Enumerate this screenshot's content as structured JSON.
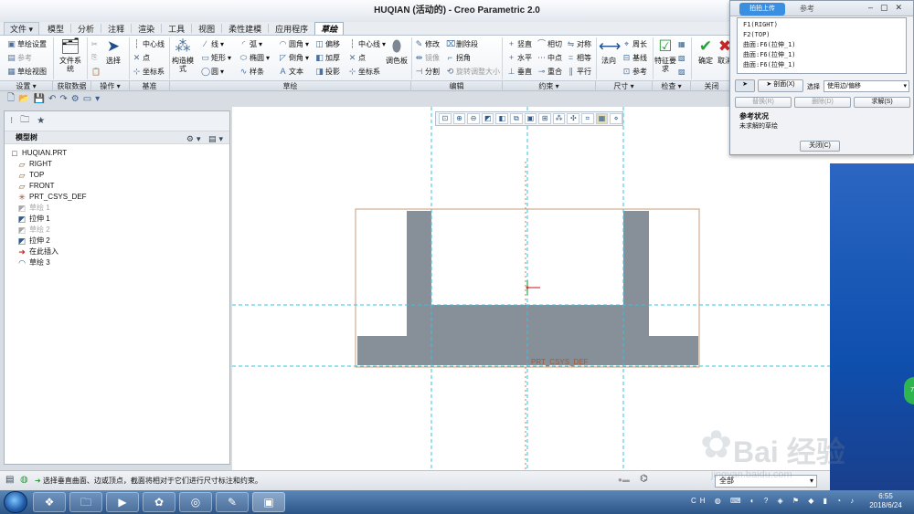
{
  "window": {
    "title": "HUQIAN (活动的) - Creo Parametric 2.0"
  },
  "tabs": [
    {
      "label": "文件 ▾"
    },
    {
      "label": "模型"
    },
    {
      "label": "分析"
    },
    {
      "label": "注释"
    },
    {
      "label": "渲染"
    },
    {
      "label": "工具"
    },
    {
      "label": "视图"
    },
    {
      "label": "柔性建模"
    },
    {
      "label": "应用程序"
    },
    {
      "label": "草绘"
    }
  ],
  "ribbon": {
    "setup": {
      "sketch_setup": "草绘设置",
      "reference": "参考",
      "sketch_view": "草绘视图"
    },
    "data": {
      "file_system": "文件系统"
    },
    "ops": {
      "select": "选择"
    },
    "datum": {
      "centerline": "中心线",
      "point": "点",
      "csys": "坐标系"
    },
    "sketch": {
      "construction": "构造模式",
      "line": "线",
      "rectangle": "矩形",
      "circle": "圆",
      "arc": "弧",
      "ellipse": "椭圆",
      "spline": "样条",
      "fillet": "圆角",
      "chamfer": "倒角",
      "text": "文本",
      "offset": "偏移",
      "thicken": "加厚",
      "project": "投影",
      "centerline": "中心线",
      "point": "点",
      "csys": "坐标系",
      "palette": "调色板"
    },
    "edit": {
      "modify": "修改",
      "mirror": "镜像",
      "divide": "分割",
      "delete_segment": "删除段",
      "corner": "拐角",
      "rotate_resize": "旋转调整大小"
    },
    "constrain": {
      "vertical": "竖直",
      "horizontal": "水平",
      "perpendicular": "垂直",
      "tangent": "相切",
      "midpoint": "中点",
      "coincident": "重合",
      "symmetric": "对称",
      "equal": "相等",
      "parallel": "平行"
    },
    "dimension": {
      "normal": "法向",
      "perimeter": "周长",
      "baseline": "基线",
      "reference": "参考"
    },
    "inspect": {
      "feature_requirements": "特征要求"
    },
    "close": {
      "ok": "确定",
      "cancel": "取消"
    }
  },
  "groups": [
    {
      "label": "设置 ▾"
    },
    {
      "label": "获取数据"
    },
    {
      "label": "操作 ▾"
    },
    {
      "label": "基准"
    },
    {
      "label": "草绘"
    },
    {
      "label": "编辑"
    },
    {
      "label": "约束 ▾"
    },
    {
      "label": "尺寸 ▾"
    },
    {
      "label": "检查 ▾"
    },
    {
      "label": "关闭"
    }
  ],
  "model_tree": {
    "header": "模型树",
    "items": [
      {
        "label": "HUQIAN.PRT",
        "icon": "□",
        "dim": false
      },
      {
        "label": "RIGHT",
        "icon": "▱",
        "dim": false
      },
      {
        "label": "TOP",
        "icon": "▱",
        "dim": false
      },
      {
        "label": "FRONT",
        "icon": "▱",
        "dim": false
      },
      {
        "label": "PRT_CSYS_DEF",
        "icon": "✳",
        "dim": false
      },
      {
        "label": "草绘 1",
        "icon": "◩",
        "dim": true
      },
      {
        "label": "拉伸 1",
        "icon": "◩",
        "dim": false
      },
      {
        "label": "草绘 2",
        "icon": "◩",
        "dim": true
      },
      {
        "label": "拉伸 2",
        "icon": "◩",
        "dim": false
      },
      {
        "label": "在此插入",
        "icon": "➜",
        "dim": false
      },
      {
        "label": "草绘 3",
        "icon": "◠",
        "dim": false
      }
    ]
  },
  "canvas": {
    "csys_label": "PRT_CSYS_DEF"
  },
  "status": {
    "message": "选择垂直曲面、边或顶点，截面将相对于它们进行尺寸标注和约束。",
    "filter": "全部"
  },
  "dialog": {
    "upload_label": "拍拍上传",
    "title": "参考",
    "references": [
      "F1(RIGHT)",
      "F2(TOP)",
      "曲面:F6(拉伸_1)",
      "曲面:F6(拉伸_1)",
      "曲面:F6(拉伸_1)"
    ],
    "section_label": "剖面(X)",
    "select_label": "选择",
    "select_value": "使用边/偏移",
    "replace_label": "替换(R)",
    "delete_label": "删除(D)",
    "solve_label": "求解(S)",
    "status_title": "参考状况",
    "status_text": "未求解的草绘",
    "close_label": "关闭(C)"
  },
  "taskbar": {
    "time": "6:55",
    "date": "2018/6/24",
    "lang": "CH"
  },
  "watermark": {
    "brand": "Bai 经验",
    "url": "jingyan.baidu.com"
  },
  "bubble": {
    "value": "75"
  }
}
